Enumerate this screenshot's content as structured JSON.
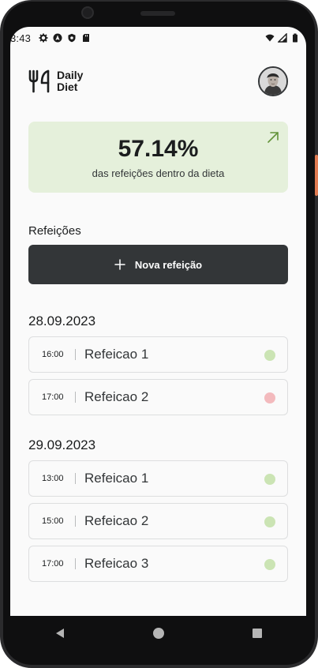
{
  "status_bar": {
    "time": "3:43",
    "left_icons": [
      "settings-icon",
      "android-auto-icon",
      "shield-icon",
      "sd-card-icon"
    ],
    "right_icons": [
      "wifi-icon",
      "cell-signal-icon",
      "battery-icon"
    ]
  },
  "header": {
    "logo_line1": "Daily",
    "logo_line2": "Diet",
    "logo_icon": "fork-knife-icon",
    "avatar": "user-avatar"
  },
  "stats": {
    "percent": "57.14%",
    "caption": "das refeições dentro da dieta",
    "arrow_icon": "arrow-up-right-icon",
    "color": "#e5f0db",
    "accent": "#639339"
  },
  "meals_section": {
    "label": "Refeições",
    "new_button_label": "Nova refeição",
    "new_button_icon": "plus-icon"
  },
  "days": [
    {
      "date": "28.09.2023",
      "meals": [
        {
          "time": "16:00",
          "name": "Refeicao 1",
          "in_diet": true
        },
        {
          "time": "17:00",
          "name": "Refeicao 2",
          "in_diet": false
        }
      ]
    },
    {
      "date": "29.09.2023",
      "meals": [
        {
          "time": "13:00",
          "name": "Refeicao 1",
          "in_diet": true
        },
        {
          "time": "15:00",
          "name": "Refeicao 2",
          "in_diet": true
        },
        {
          "time": "17:00",
          "name": "Refeicao 3",
          "in_diet": true
        }
      ]
    }
  ],
  "colors": {
    "in_diet_dot": "#cbe4b4",
    "off_diet_dot": "#f3babd",
    "dark": "#333638"
  },
  "nav": {
    "back_icon": "back-triangle-icon",
    "home_icon": "home-circle-icon",
    "recents_icon": "recents-square-icon"
  }
}
